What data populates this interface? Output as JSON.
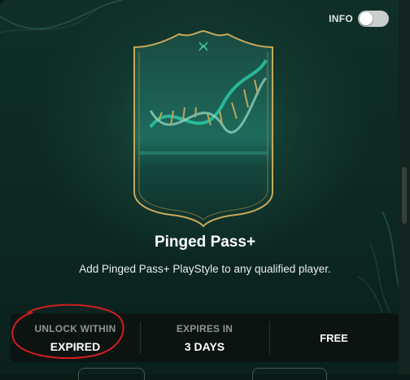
{
  "toggle": {
    "label": "INFO",
    "on": false
  },
  "item": {
    "title": "Pinged Pass+",
    "description": "Add Pinged Pass+ PlayStyle to any qualified player."
  },
  "stats": [
    {
      "label": "UNLOCK WITHIN",
      "value": "EXPIRED"
    },
    {
      "label": "EXPIRES IN",
      "value": "3 DAYS"
    },
    {
      "label": "",
      "value": "FREE"
    }
  ],
  "colors": {
    "accent_gold": "#c8a85a",
    "card_teal": "#1e6b5c",
    "annotation_red": "#d21f1f"
  }
}
